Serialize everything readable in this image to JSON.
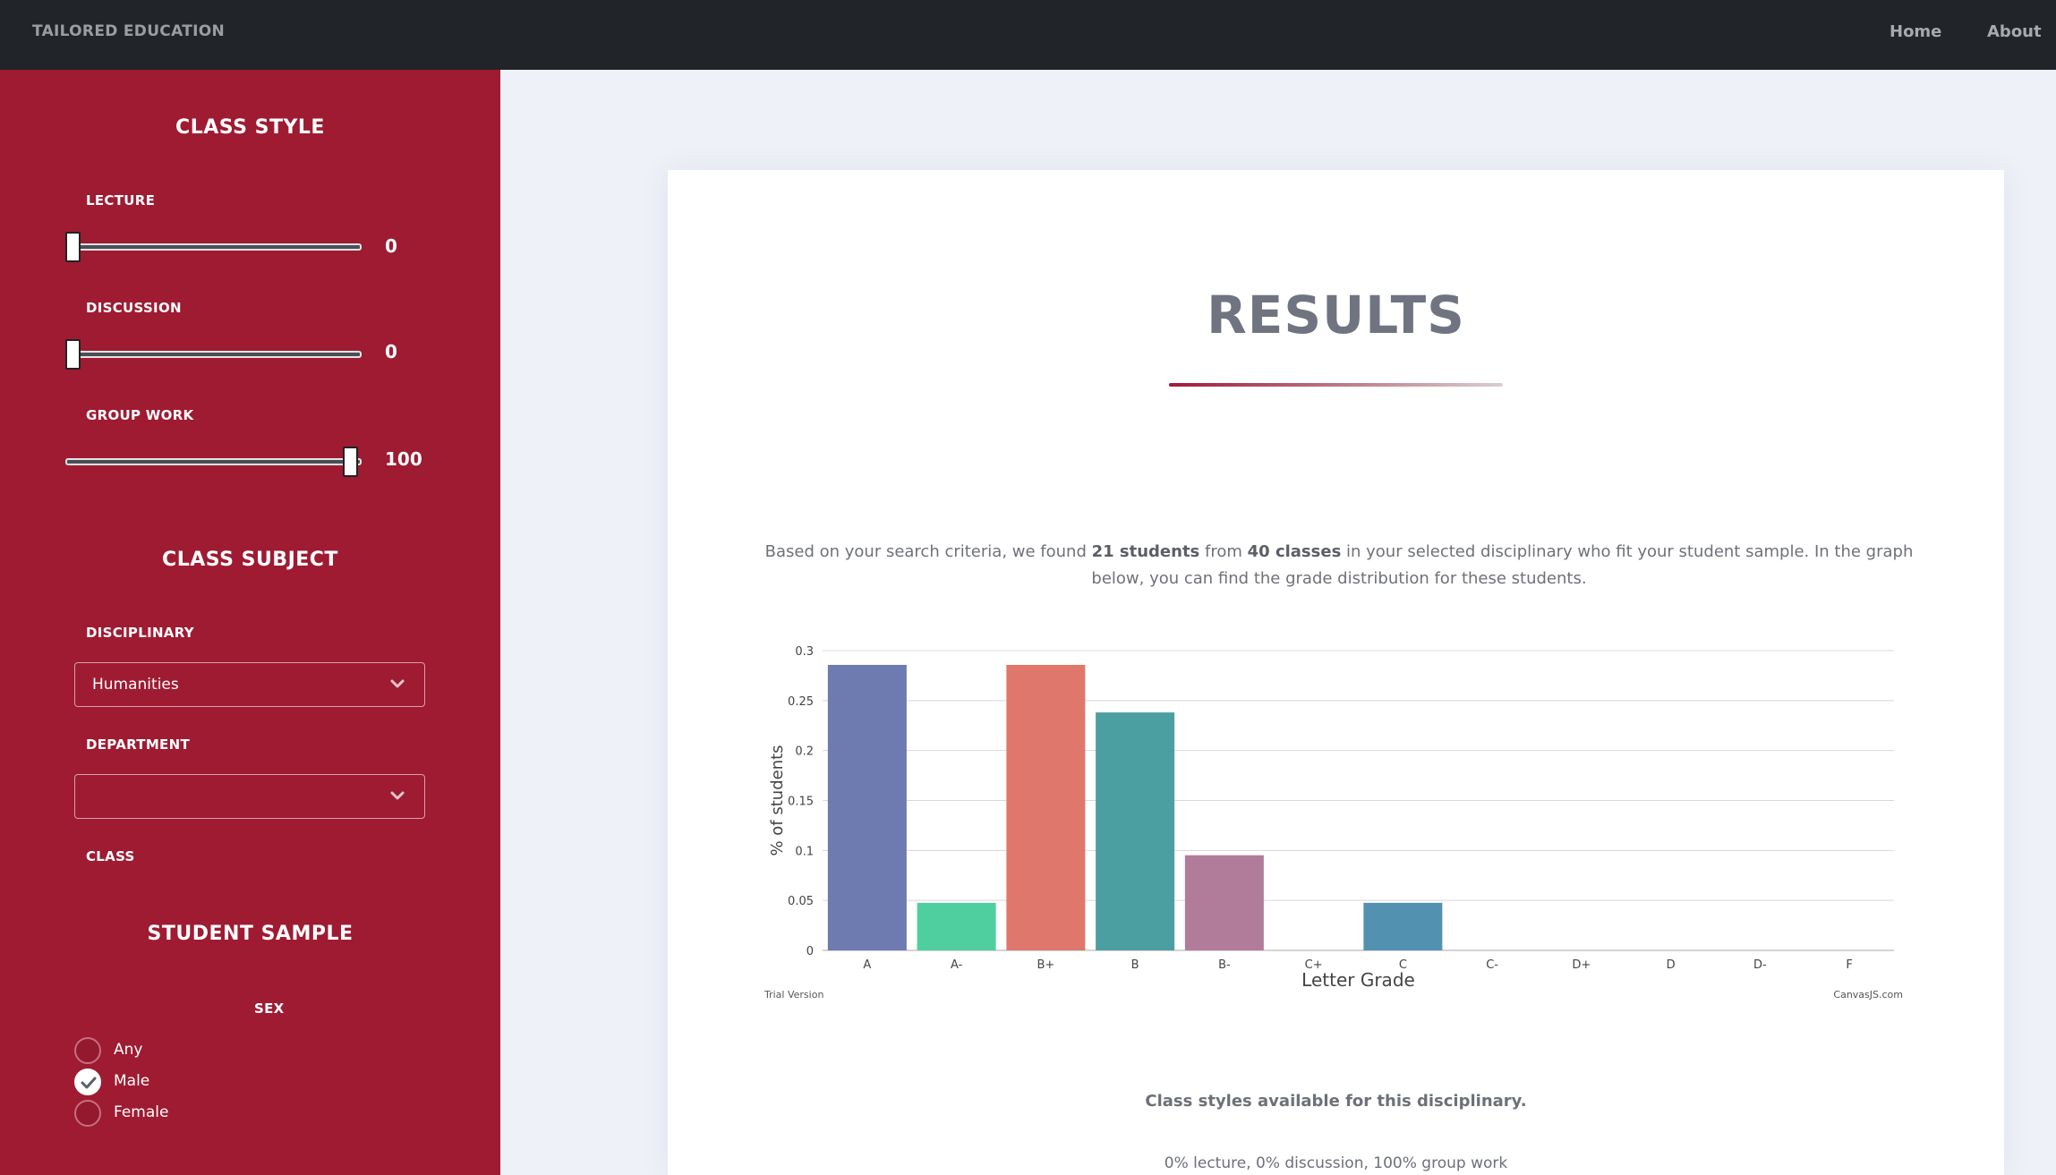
{
  "nav": {
    "brand": "TAILORED EDUCATION",
    "home": "Home",
    "about": "About"
  },
  "sidebar": {
    "class_style": {
      "title": "CLASS STYLE",
      "lecture": {
        "label": "LECTURE",
        "value": "0",
        "level": 0
      },
      "discussion": {
        "label": "DISCUSSION",
        "value": "0",
        "level": 0
      },
      "group_work": {
        "label": "GROUP WORK",
        "value": "100",
        "level": 100
      }
    },
    "class_subject": {
      "title": "CLASS SUBJECT",
      "disciplinary_label": "DISCIPLINARY",
      "disciplinary_value": "Humanities",
      "department_label": "DEPARTMENT",
      "department_value": "",
      "class_label": "CLASS"
    },
    "student_sample": {
      "title": "STUDENT SAMPLE",
      "sex_label": "SEX",
      "options": [
        {
          "label": "Any",
          "checked": false
        },
        {
          "label": "Male",
          "checked": true
        },
        {
          "label": "Female",
          "checked": false
        }
      ]
    }
  },
  "main": {
    "title": "RESULTS",
    "summary": {
      "part1": "Based on your search criteria, we found ",
      "students": "21 students",
      "part2": " from ",
      "classes": "40 classes",
      "part3": " in your selected disciplinary who fit your student sample. In the graph below, you can find the grade distribution for these students."
    },
    "styles_heading": "Class styles available for this disciplinary.",
    "styles_text": "0% lecture, 0% discussion, 100% group work"
  },
  "chart_data": {
    "type": "bar",
    "categories": [
      "A",
      "A-",
      "B+",
      "B",
      "B-",
      "C+",
      "C",
      "C-",
      "D+",
      "D",
      "D-",
      "F"
    ],
    "values": [
      0.2857,
      0.0476,
      0.2857,
      0.2381,
      0.0952,
      0,
      0.0476,
      0,
      0,
      0,
      0,
      0
    ],
    "colors": [
      "#6d7bb0",
      "#4fcf9f",
      "#df776d",
      "#4c9fa0",
      "#b07c9a",
      "#6aa0c0",
      "#5291b0",
      "#7a8fd0",
      "#8fc07a",
      "#c0a070",
      "#a080c0",
      "#70a0a0"
    ],
    "y_ticks": [
      "0",
      "0.05",
      "0.1",
      "0.15",
      "0.2",
      "0.25",
      "0.3"
    ],
    "ylim": [
      0,
      0.3
    ],
    "xlabel": "Letter Grade",
    "ylabel": "% of students",
    "grid": true,
    "watermark_left": "Trial Version",
    "watermark_right": "CanvasJS.com"
  }
}
